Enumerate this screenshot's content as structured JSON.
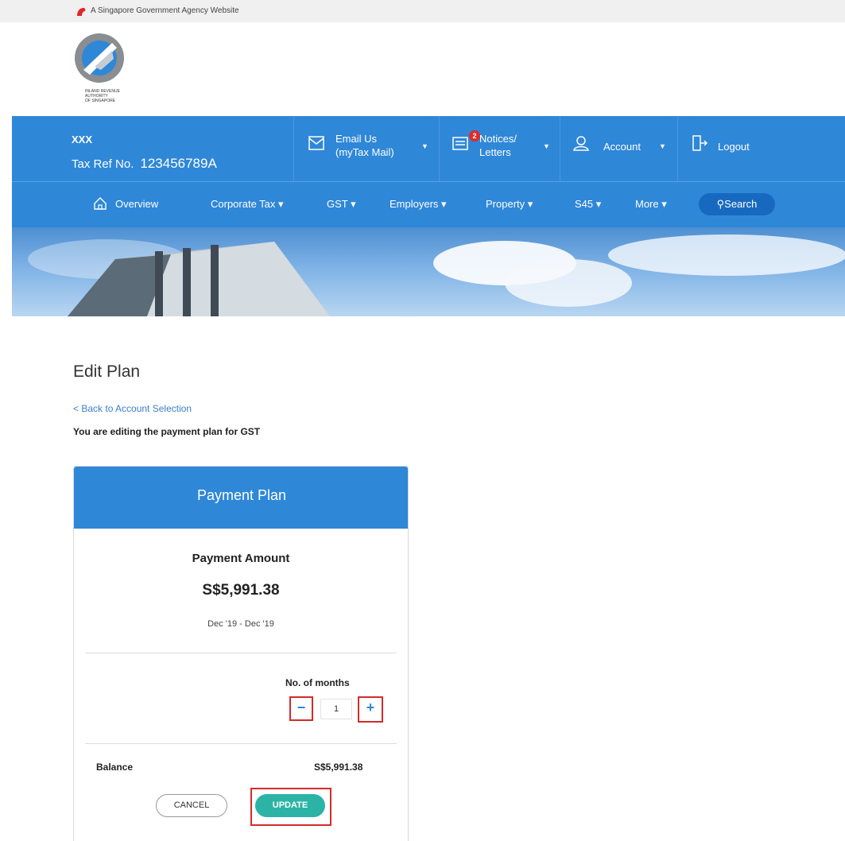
{
  "gov_banner": {
    "text": "A Singapore Government Agency Website"
  },
  "logo": {
    "lines": [
      "INLAND REVENUE",
      "AUTHORITY",
      "OF SINGAPORE"
    ]
  },
  "header": {
    "user_name": "XXX",
    "tax_ref_label": "Tax Ref No.",
    "tax_ref_number": "123456789A",
    "email": {
      "line1": "Email Us",
      "line2": "(myTax Mail)"
    },
    "notices": {
      "line1": "Notices/",
      "line2": "Letters",
      "badge_count": "2"
    },
    "account_label": "Account",
    "logout_label": "Logout"
  },
  "nav": {
    "items": [
      "Overview",
      "Corporate Tax",
      "GST",
      "Employers",
      "Property",
      "S45",
      "More"
    ],
    "search_label": "Search"
  },
  "page": {
    "title": "Edit Plan",
    "back_link": "< Back to Account Selection",
    "editing_text": "You are editing the payment plan for GST"
  },
  "card": {
    "header_title": "Payment Plan",
    "amount_label": "Payment Amount",
    "amount_value": "S$5,991.38",
    "amount_period": "Dec '19 - Dec '19",
    "months_label": "No. of months",
    "months_value": "1",
    "minus_symbol": "−",
    "plus_symbol": "+",
    "balance_label": "Balance",
    "balance_value": "S$5,991.38",
    "cancel_label": "CANCEL",
    "update_label": "UPDATE"
  },
  "colors": {
    "brand_blue": "#2f87d8",
    "search_blue": "#1769c0",
    "update_teal": "#2bb4a6",
    "highlight_red": "#d62a2a",
    "link_blue": "#3a7fce"
  }
}
